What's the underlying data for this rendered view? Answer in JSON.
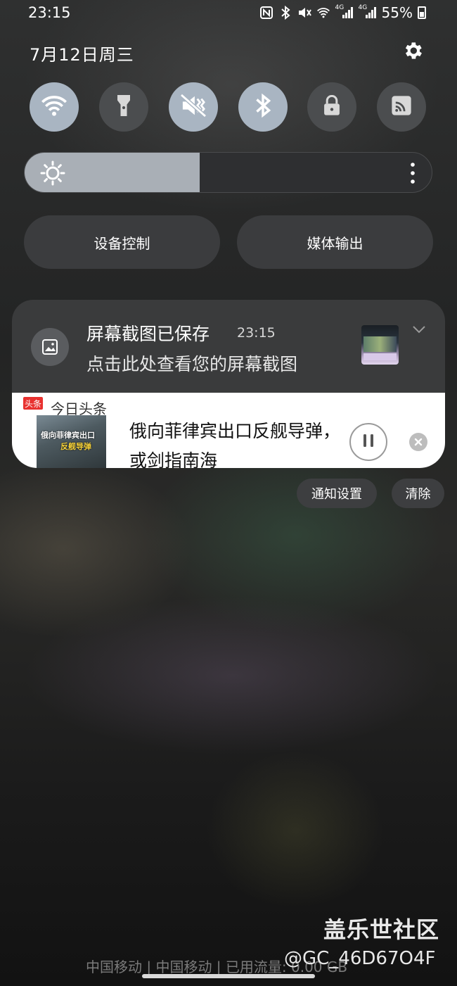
{
  "status_bar": {
    "time": "23:15",
    "battery": "55%",
    "network_labels": [
      "4G",
      "4G"
    ],
    "icons": [
      "nfc-icon",
      "bluetooth-icon",
      "mute-icon",
      "wifi-icon",
      "signal-icon",
      "signal-icon",
      "battery-icon"
    ]
  },
  "header": {
    "date": "7月12日周三",
    "settings_icon": "gear-icon"
  },
  "quick_toggles": [
    {
      "name": "wifi",
      "icon": "wifi-icon",
      "state": "on"
    },
    {
      "name": "flashlight",
      "icon": "flashlight-icon",
      "state": "off"
    },
    {
      "name": "mute",
      "icon": "mute-icon",
      "state": "on"
    },
    {
      "name": "bluetooth",
      "icon": "bluetooth-icon",
      "state": "on"
    },
    {
      "name": "lock",
      "icon": "lock-icon",
      "state": "off"
    },
    {
      "name": "cast",
      "icon": "cast-icon",
      "state": "off"
    }
  ],
  "brightness": {
    "level": 0.43
  },
  "pills": {
    "device_control": "设备控制",
    "media_output": "媒体输出"
  },
  "screenshot_notification": {
    "title": "屏幕截图已保存",
    "time": "23:15",
    "message": "点击此处查看您的屏幕截图"
  },
  "media_notification": {
    "badge": "头条",
    "app_name": "今日头条",
    "cover_line1": "俄向菲律宾出口",
    "cover_line2": "反舰导弹",
    "headline": "俄向菲律宾出口反舰导弹，或剑指南海"
  },
  "actions": {
    "notification_settings": "通知设置",
    "clear": "清除"
  },
  "footer": {
    "watermark_site": "盖乐世社区",
    "carrier_text": "中国移动 | 中国移动 | 已用流量: 0.00 GB",
    "watermark_user": "@GC_46D67O4F"
  },
  "colors": {
    "toggle_on": "#a9b5c2",
    "toggle_off": "#4b4d4f",
    "badge_red": "#e8312f"
  }
}
